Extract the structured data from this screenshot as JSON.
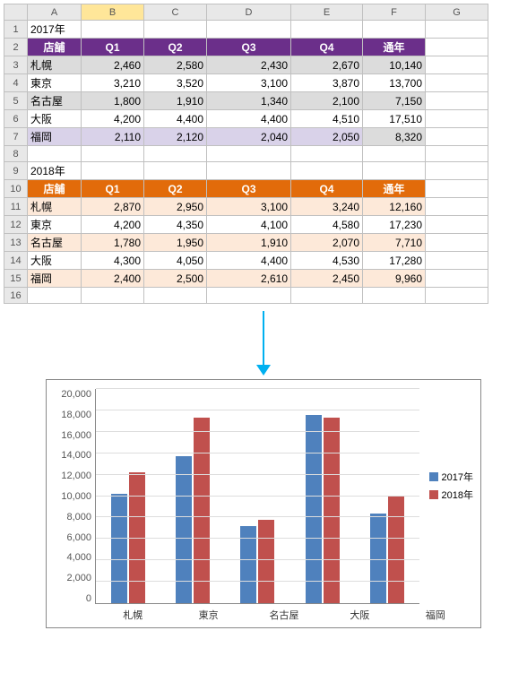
{
  "columns": [
    "A",
    "B",
    "C",
    "D",
    "E",
    "F",
    "G"
  ],
  "year2017_label": "2017年",
  "year2018_label": "2018年",
  "headers1": {
    "store": "店舗",
    "q1": "Q1",
    "q2": "Q2",
    "q3": "Q3",
    "q4": "Q4",
    "total": "通年"
  },
  "headers2": {
    "store": "店舗",
    "q1": "Q1",
    "q2": "Q2",
    "q3": "Q3",
    "q4": "Q4",
    "total": "通年"
  },
  "table2017": [
    {
      "store": "札幌",
      "q1": "2,460",
      "q2": "2,580",
      "q3": "2,430",
      "q4": "2,670",
      "total": "10,140"
    },
    {
      "store": "東京",
      "q1": "3,210",
      "q2": "3,520",
      "q3": "3,100",
      "q4": "3,870",
      "total": "13,700"
    },
    {
      "store": "名古屋",
      "q1": "1,800",
      "q2": "1,910",
      "q3": "1,340",
      "q4": "2,100",
      "total": "7,150"
    },
    {
      "store": "大阪",
      "q1": "4,200",
      "q2": "4,400",
      "q3": "4,400",
      "q4": "4,510",
      "total": "17,510"
    },
    {
      "store": "福岡",
      "q1": "2,110",
      "q2": "2,120",
      "q3": "2,040",
      "q4": "2,050",
      "total": "8,320"
    }
  ],
  "table2018": [
    {
      "store": "札幌",
      "q1": "2,870",
      "q2": "2,950",
      "q3": "3,100",
      "q4": "3,240",
      "total": "12,160"
    },
    {
      "store": "東京",
      "q1": "4,200",
      "q2": "4,350",
      "q3": "4,100",
      "q4": "4,580",
      "total": "17,230"
    },
    {
      "store": "名古屋",
      "q1": "1,780",
      "q2": "1,950",
      "q3": "1,910",
      "q4": "2,070",
      "total": "7,710"
    },
    {
      "store": "大阪",
      "q1": "4,300",
      "q2": "4,050",
      "q3": "4,400",
      "q4": "4,530",
      "total": "17,280"
    },
    {
      "store": "福岡",
      "q1": "2,400",
      "q2": "2,500",
      "q3": "2,610",
      "q4": "2,450",
      "total": "9,960"
    }
  ],
  "chart_data": {
    "type": "bar",
    "categories": [
      "札幌",
      "東京",
      "名古屋",
      "大阪",
      "福岡"
    ],
    "series": [
      {
        "name": "2017年",
        "values": [
          10140,
          13700,
          7150,
          17510,
          8320
        ]
      },
      {
        "name": "2018年",
        "values": [
          12160,
          17230,
          7710,
          17280,
          9960
        ]
      }
    ],
    "ylim": [
      0,
      20000
    ],
    "yticks": [
      0,
      2000,
      4000,
      6000,
      8000,
      10000,
      12000,
      14000,
      16000,
      18000,
      20000
    ],
    "ytick_labels": [
      "0",
      "2,000",
      "4,000",
      "6,000",
      "8,000",
      "10,000",
      "12,000",
      "14,000",
      "16,000",
      "18,000",
      "20,000"
    ],
    "title": "",
    "xlabel": "",
    "ylabel": ""
  },
  "legend": {
    "s2017": "2017年",
    "s2018": "2018年"
  }
}
